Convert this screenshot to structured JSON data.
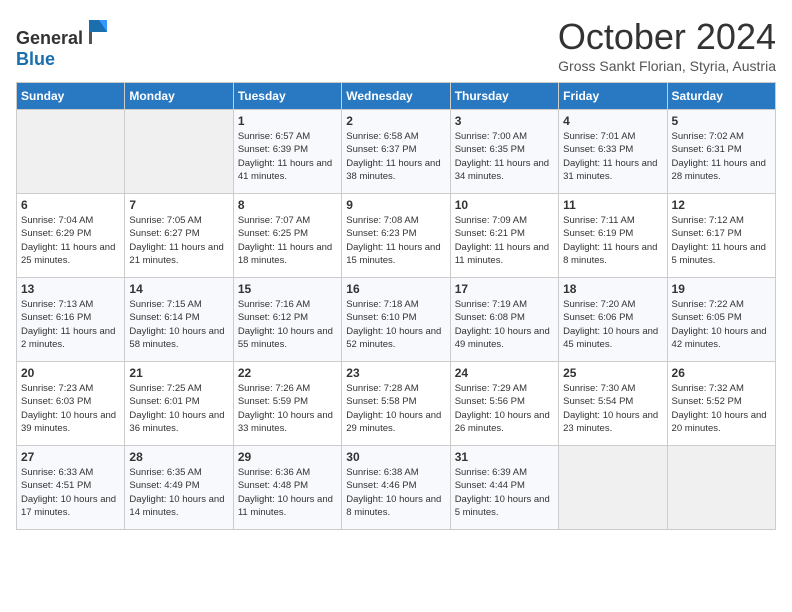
{
  "header": {
    "logo_general": "General",
    "logo_blue": "Blue",
    "title": "October 2024",
    "subtitle": "Gross Sankt Florian, Styria, Austria"
  },
  "days_of_week": [
    "Sunday",
    "Monday",
    "Tuesday",
    "Wednesday",
    "Thursday",
    "Friday",
    "Saturday"
  ],
  "weeks": [
    [
      {
        "day": "",
        "info": ""
      },
      {
        "day": "",
        "info": ""
      },
      {
        "day": "1",
        "info": "Sunrise: 6:57 AM\nSunset: 6:39 PM\nDaylight: 11 hours and 41 minutes."
      },
      {
        "day": "2",
        "info": "Sunrise: 6:58 AM\nSunset: 6:37 PM\nDaylight: 11 hours and 38 minutes."
      },
      {
        "day": "3",
        "info": "Sunrise: 7:00 AM\nSunset: 6:35 PM\nDaylight: 11 hours and 34 minutes."
      },
      {
        "day": "4",
        "info": "Sunrise: 7:01 AM\nSunset: 6:33 PM\nDaylight: 11 hours and 31 minutes."
      },
      {
        "day": "5",
        "info": "Sunrise: 7:02 AM\nSunset: 6:31 PM\nDaylight: 11 hours and 28 minutes."
      }
    ],
    [
      {
        "day": "6",
        "info": "Sunrise: 7:04 AM\nSunset: 6:29 PM\nDaylight: 11 hours and 25 minutes."
      },
      {
        "day": "7",
        "info": "Sunrise: 7:05 AM\nSunset: 6:27 PM\nDaylight: 11 hours and 21 minutes."
      },
      {
        "day": "8",
        "info": "Sunrise: 7:07 AM\nSunset: 6:25 PM\nDaylight: 11 hours and 18 minutes."
      },
      {
        "day": "9",
        "info": "Sunrise: 7:08 AM\nSunset: 6:23 PM\nDaylight: 11 hours and 15 minutes."
      },
      {
        "day": "10",
        "info": "Sunrise: 7:09 AM\nSunset: 6:21 PM\nDaylight: 11 hours and 11 minutes."
      },
      {
        "day": "11",
        "info": "Sunrise: 7:11 AM\nSunset: 6:19 PM\nDaylight: 11 hours and 8 minutes."
      },
      {
        "day": "12",
        "info": "Sunrise: 7:12 AM\nSunset: 6:17 PM\nDaylight: 11 hours and 5 minutes."
      }
    ],
    [
      {
        "day": "13",
        "info": "Sunrise: 7:13 AM\nSunset: 6:16 PM\nDaylight: 11 hours and 2 minutes."
      },
      {
        "day": "14",
        "info": "Sunrise: 7:15 AM\nSunset: 6:14 PM\nDaylight: 10 hours and 58 minutes."
      },
      {
        "day": "15",
        "info": "Sunrise: 7:16 AM\nSunset: 6:12 PM\nDaylight: 10 hours and 55 minutes."
      },
      {
        "day": "16",
        "info": "Sunrise: 7:18 AM\nSunset: 6:10 PM\nDaylight: 10 hours and 52 minutes."
      },
      {
        "day": "17",
        "info": "Sunrise: 7:19 AM\nSunset: 6:08 PM\nDaylight: 10 hours and 49 minutes."
      },
      {
        "day": "18",
        "info": "Sunrise: 7:20 AM\nSunset: 6:06 PM\nDaylight: 10 hours and 45 minutes."
      },
      {
        "day": "19",
        "info": "Sunrise: 7:22 AM\nSunset: 6:05 PM\nDaylight: 10 hours and 42 minutes."
      }
    ],
    [
      {
        "day": "20",
        "info": "Sunrise: 7:23 AM\nSunset: 6:03 PM\nDaylight: 10 hours and 39 minutes."
      },
      {
        "day": "21",
        "info": "Sunrise: 7:25 AM\nSunset: 6:01 PM\nDaylight: 10 hours and 36 minutes."
      },
      {
        "day": "22",
        "info": "Sunrise: 7:26 AM\nSunset: 5:59 PM\nDaylight: 10 hours and 33 minutes."
      },
      {
        "day": "23",
        "info": "Sunrise: 7:28 AM\nSunset: 5:58 PM\nDaylight: 10 hours and 29 minutes."
      },
      {
        "day": "24",
        "info": "Sunrise: 7:29 AM\nSunset: 5:56 PM\nDaylight: 10 hours and 26 minutes."
      },
      {
        "day": "25",
        "info": "Sunrise: 7:30 AM\nSunset: 5:54 PM\nDaylight: 10 hours and 23 minutes."
      },
      {
        "day": "26",
        "info": "Sunrise: 7:32 AM\nSunset: 5:52 PM\nDaylight: 10 hours and 20 minutes."
      }
    ],
    [
      {
        "day": "27",
        "info": "Sunrise: 6:33 AM\nSunset: 4:51 PM\nDaylight: 10 hours and 17 minutes."
      },
      {
        "day": "28",
        "info": "Sunrise: 6:35 AM\nSunset: 4:49 PM\nDaylight: 10 hours and 14 minutes."
      },
      {
        "day": "29",
        "info": "Sunrise: 6:36 AM\nSunset: 4:48 PM\nDaylight: 10 hours and 11 minutes."
      },
      {
        "day": "30",
        "info": "Sunrise: 6:38 AM\nSunset: 4:46 PM\nDaylight: 10 hours and 8 minutes."
      },
      {
        "day": "31",
        "info": "Sunrise: 6:39 AM\nSunset: 4:44 PM\nDaylight: 10 hours and 5 minutes."
      },
      {
        "day": "",
        "info": ""
      },
      {
        "day": "",
        "info": ""
      }
    ]
  ]
}
